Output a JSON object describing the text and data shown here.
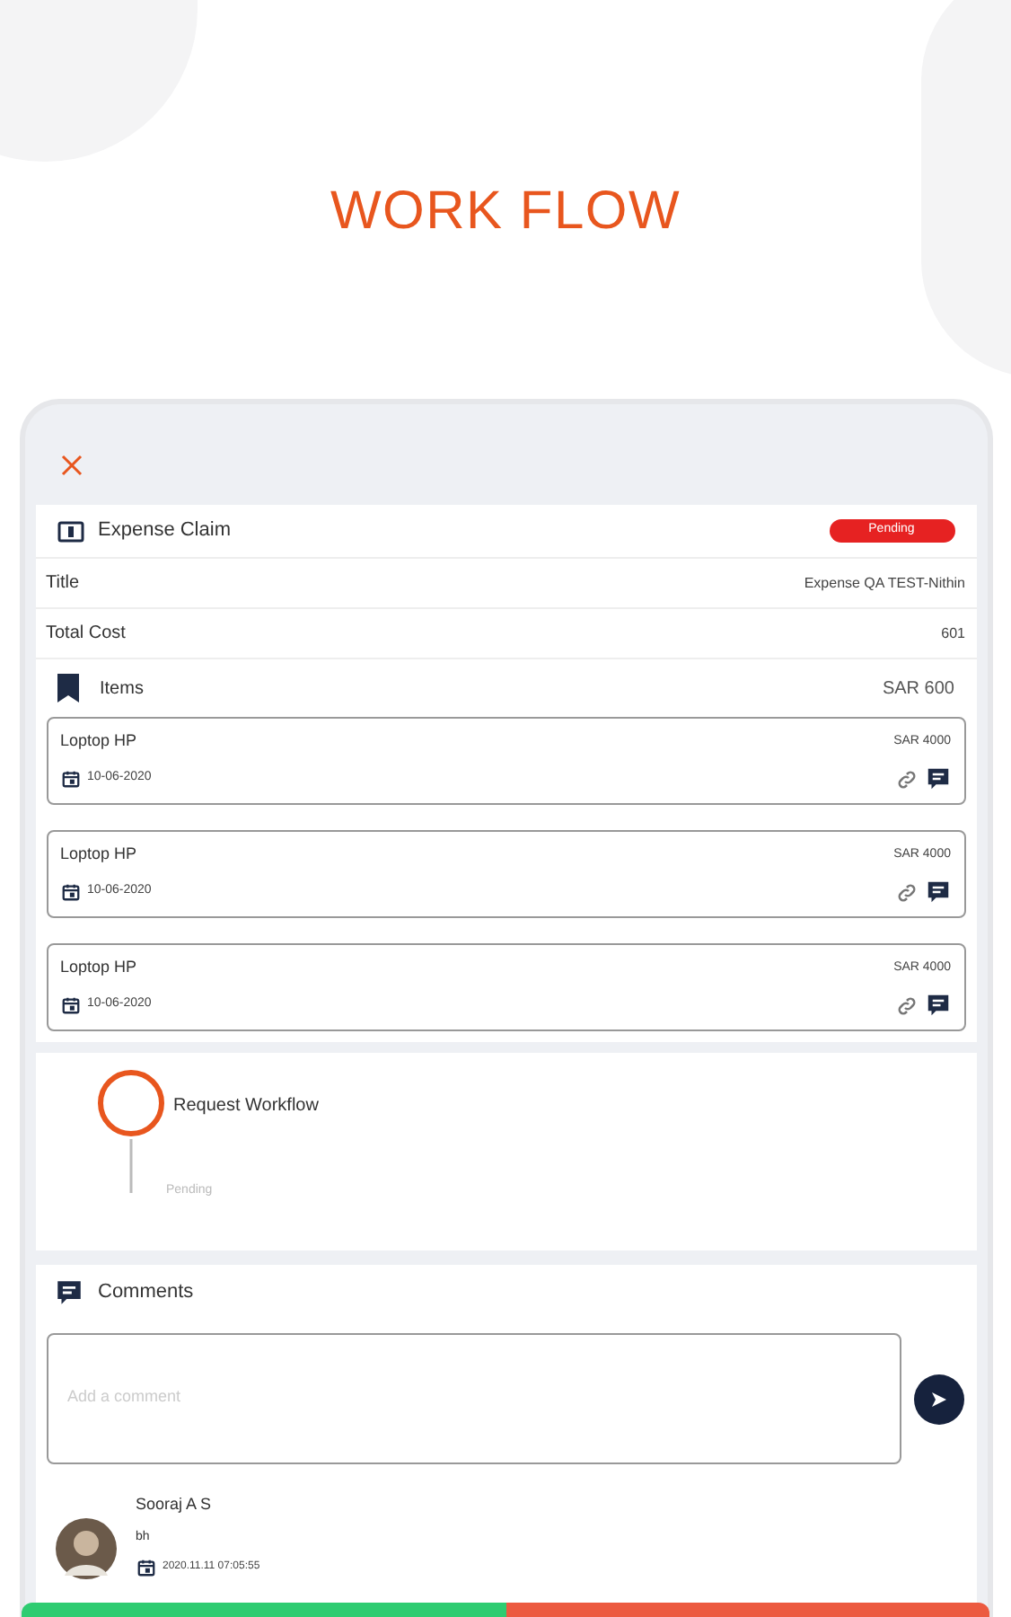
{
  "heading": "WORK FLOW",
  "claim": {
    "title": "Expense Claim",
    "status": "Pending"
  },
  "fields": [
    {
      "label": "Title",
      "value": "Expense QA TEST-Nithin"
    },
    {
      "label": "Total Cost",
      "value": "601"
    }
  ],
  "items_header": {
    "label": "Items",
    "total": "SAR 600"
  },
  "items": [
    {
      "name": "Loptop HP",
      "amount": "SAR 4000",
      "date": "10-06-2020"
    },
    {
      "name": "Loptop HP",
      "amount": "SAR 4000",
      "date": "10-06-2020"
    },
    {
      "name": "Loptop HP",
      "amount": "SAR 4000",
      "date": "10-06-2020"
    }
  ],
  "workflow": {
    "title": "Request Workflow",
    "status": "Pending"
  },
  "comments": {
    "title": "Comments",
    "placeholder": "Add a comment",
    "entries": [
      {
        "author": "Sooraj A S",
        "text": "bh",
        "time": "2020.11.11 07:05:55"
      }
    ]
  }
}
